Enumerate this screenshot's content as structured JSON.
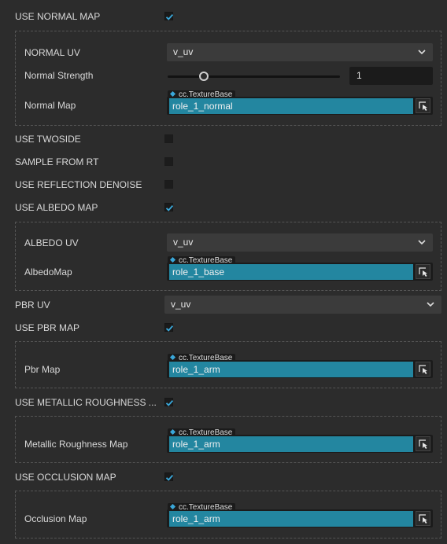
{
  "use_normal_map": {
    "label": "USE NORMAL MAP",
    "checked": true
  },
  "normal_group": {
    "normal_uv": {
      "label": "NORMAL UV",
      "value": "v_uv"
    },
    "normal_strength": {
      "label": "Normal Strength",
      "value": "1",
      "slider_fraction": 0.21
    },
    "normal_map": {
      "label": "Normal Map",
      "type_tag": "cc.TextureBase",
      "value": "role_1_normal"
    }
  },
  "use_twoside": {
    "label": "USE TWOSIDE",
    "checked": false
  },
  "sample_from_rt": {
    "label": "SAMPLE FROM RT",
    "checked": false
  },
  "use_reflection_denoise": {
    "label": "USE REFLECTION DENOISE",
    "checked": false
  },
  "use_albedo_map": {
    "label": "USE ALBEDO MAP",
    "checked": true
  },
  "albedo_group": {
    "albedo_uv": {
      "label": "ALBEDO UV",
      "value": "v_uv"
    },
    "albedo_map": {
      "label": "AlbedoMap",
      "type_tag": "cc.TextureBase",
      "value": "role_1_base"
    }
  },
  "pbr_uv": {
    "label": "PBR UV",
    "value": "v_uv"
  },
  "use_pbr_map": {
    "label": "USE PBR MAP",
    "checked": true
  },
  "pbr_group": {
    "pbr_map": {
      "label": "Pbr Map",
      "type_tag": "cc.TextureBase",
      "value": "role_1_arm"
    }
  },
  "use_metallic_roughness": {
    "label": "USE METALLIC ROUGHNESS ...",
    "checked": true
  },
  "metallic_group": {
    "metallic_roughness_map": {
      "label": "Metallic Roughness Map",
      "type_tag": "cc.TextureBase",
      "value": "role_1_arm"
    }
  },
  "use_occlusion_map": {
    "label": "USE OCCLUSION MAP",
    "checked": true
  },
  "occlusion_group": {
    "occlusion_map": {
      "label": "Occlusion Map",
      "type_tag": "cc.TextureBase",
      "value": "role_1_arm"
    }
  },
  "colors": {
    "accent": "#2386a0",
    "checkmark": "#3aa7d9",
    "background": "#2c2c2c"
  },
  "icons": {
    "check": "check-icon",
    "chevron": "chevron-down-icon",
    "picker": "asset-picker-icon",
    "diamond": "asset-type-icon"
  }
}
